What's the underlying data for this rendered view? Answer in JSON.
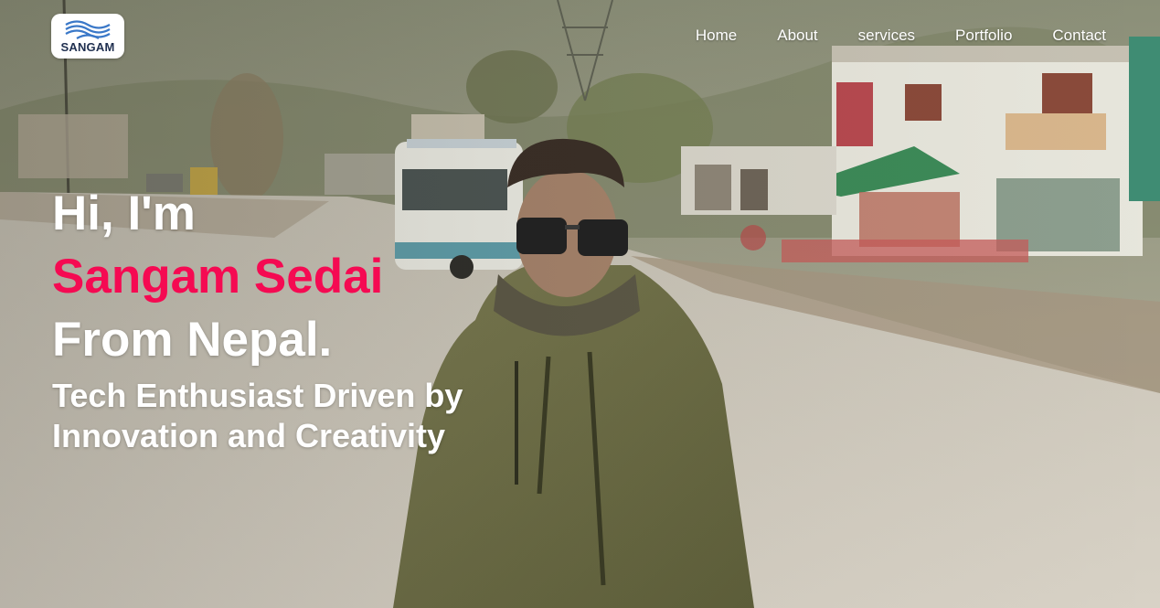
{
  "brand": {
    "logo_text": "SANGAM",
    "logo_icon": "waves-logo-icon",
    "colors": {
      "logo_waves": "#3a78c8",
      "logo_text": "#1f2f4f"
    }
  },
  "nav": {
    "items": [
      {
        "label": "Home"
      },
      {
        "label": "About"
      },
      {
        "label": "services"
      },
      {
        "label": "Portfolio"
      },
      {
        "label": "Contact"
      }
    ]
  },
  "hero": {
    "greeting": "Hi, I'm",
    "name": "Sangam Sedai",
    "origin": "From Nepal.",
    "tagline_line1": "Tech Enthusiast Driven by",
    "tagline_line2": "Innovation and Creativity",
    "colors": {
      "name_accent": "#f50a52",
      "text": "#ffffff"
    }
  }
}
